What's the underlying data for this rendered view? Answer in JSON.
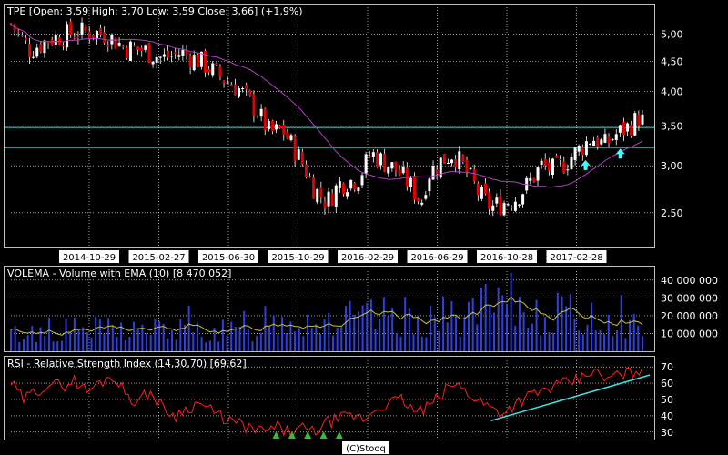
{
  "colors": {
    "background": "#000000",
    "frame": "#c0c0c0",
    "grid": "#ffffff",
    "candle_up": "#ffffff",
    "candle_down": "#e00000",
    "wick": "#ffffff",
    "ema_price": "#b040c0",
    "volume_bar": "#3040e0",
    "volume_ema": "#c8c040",
    "rsi_line": "#ff2020",
    "trendline": "#40e0e0",
    "signal_arrow": "#40ffff",
    "rsi_marker": "#30c030"
  },
  "footer": "(C)Stooq",
  "chart_data": [
    {
      "type": "candlestick",
      "title": "TPE [Open: 3,59  High: 3,70  Low: 3,59  Close: 3,66] (+1,9%)",
      "x_labels": [
        "2014-10-29",
        "2015-02-27",
        "2015-06-30",
        "2015-10-29",
        "2016-02-29",
        "2016-06-29",
        "2016-10-28",
        "2017-02-28"
      ],
      "y_scale": "log",
      "y_ticks": [
        2.5,
        3.0,
        3.5,
        4.0,
        4.5,
        5.0
      ],
      "y_tick_labels": [
        "2,50",
        "3,00",
        "3,50",
        "4,00",
        "4,50",
        "5,00"
      ],
      "ylim": [
        2.2,
        5.55
      ],
      "horizontal_lines": [
        3.48,
        3.22
      ],
      "overlay": "moving average",
      "signal_arrows": [
        0.91,
        0.965
      ],
      "close_path": [
        [
          0,
          5.2
        ],
        [
          0.03,
          4.7
        ],
        [
          0.06,
          4.9
        ],
        [
          0.09,
          5.0
        ],
        [
          0.12,
          5.05
        ],
        [
          0.15,
          5.0
        ],
        [
          0.18,
          4.75
        ],
        [
          0.21,
          4.7
        ],
        [
          0.24,
          4.55
        ],
        [
          0.27,
          4.65
        ],
        [
          0.3,
          4.5
        ],
        [
          0.33,
          4.25
        ],
        [
          0.36,
          4.05
        ],
        [
          0.39,
          3.7
        ],
        [
          0.41,
          3.4
        ],
        [
          0.43,
          3.45
        ],
        [
          0.46,
          3.05
        ],
        [
          0.48,
          2.75
        ],
        [
          0.5,
          2.6
        ],
        [
          0.52,
          2.8
        ],
        [
          0.55,
          2.85
        ],
        [
          0.57,
          3.15
        ],
        [
          0.59,
          3.05
        ],
        [
          0.61,
          2.95
        ],
        [
          0.63,
          2.8
        ],
        [
          0.65,
          2.6
        ],
        [
          0.66,
          2.9
        ],
        [
          0.68,
          3.05
        ],
        [
          0.7,
          3.15
        ],
        [
          0.72,
          2.95
        ],
        [
          0.74,
          2.7
        ],
        [
          0.76,
          2.55
        ],
        [
          0.78,
          2.6
        ],
        [
          0.8,
          2.65
        ],
        [
          0.82,
          2.8
        ],
        [
          0.84,
          3.0
        ],
        [
          0.86,
          2.95
        ],
        [
          0.88,
          3.05
        ],
        [
          0.9,
          3.2
        ],
        [
          0.92,
          3.35
        ],
        [
          0.94,
          3.25
        ],
        [
          0.96,
          3.4
        ],
        [
          0.98,
          3.5
        ],
        [
          1,
          3.66
        ]
      ]
    },
    {
      "type": "bar",
      "title": "VOLEMA - Volume with EMA (10) [8 470 052]",
      "y_ticks": [
        10000000,
        20000000,
        30000000,
        40000000
      ],
      "y_tick_labels": [
        "10 000 000",
        "20 000 000",
        "30 000 000",
        "40 000 000"
      ],
      "ylim": [
        0,
        45000000
      ],
      "volume_profile": [
        [
          0,
          10000000
        ],
        [
          0.1,
          13000000
        ],
        [
          0.2,
          13000000
        ],
        [
          0.3,
          12000000
        ],
        [
          0.38,
          11000000
        ],
        [
          0.4,
          20000000
        ],
        [
          0.5,
          18000000
        ],
        [
          0.6,
          20000000
        ],
        [
          0.7,
          20000000
        ],
        [
          0.75,
          25000000
        ],
        [
          0.8,
          24000000
        ],
        [
          0.85,
          23000000
        ],
        [
          0.9,
          20000000
        ],
        [
          0.95,
          18000000
        ],
        [
          1,
          15000000
        ]
      ],
      "last_value": 8470052
    },
    {
      "type": "line",
      "title": "RSI - Relative Strength Index (14,30,70) [69,62]",
      "y_ticks": [
        30,
        40,
        50,
        60,
        70
      ],
      "y_tick_labels": [
        "30",
        "40",
        "50",
        "60",
        "70"
      ],
      "ylim": [
        26,
        74
      ],
      "last_value": 69.62,
      "rsi_path": [
        [
          0,
          60
        ],
        [
          0.02,
          50
        ],
        [
          0.04,
          55
        ],
        [
          0.06,
          60
        ],
        [
          0.08,
          58
        ],
        [
          0.1,
          62
        ],
        [
          0.12,
          55
        ],
        [
          0.14,
          60
        ],
        [
          0.16,
          65
        ],
        [
          0.18,
          55
        ],
        [
          0.2,
          48
        ],
        [
          0.22,
          55
        ],
        [
          0.24,
          45
        ],
        [
          0.26,
          40
        ],
        [
          0.28,
          45
        ],
        [
          0.3,
          48
        ],
        [
          0.32,
          42
        ],
        [
          0.34,
          38
        ],
        [
          0.36,
          35
        ],
        [
          0.38,
          32
        ],
        [
          0.4,
          30
        ],
        [
          0.42,
          33
        ],
        [
          0.44,
          30
        ],
        [
          0.46,
          32
        ],
        [
          0.48,
          30
        ],
        [
          0.5,
          36
        ],
        [
          0.52,
          38
        ],
        [
          0.54,
          40
        ],
        [
          0.56,
          38
        ],
        [
          0.58,
          45
        ],
        [
          0.6,
          48
        ],
        [
          0.62,
          50
        ],
        [
          0.64,
          42
        ],
        [
          0.66,
          45
        ],
        [
          0.68,
          52
        ],
        [
          0.7,
          60
        ],
        [
          0.72,
          55
        ],
        [
          0.74,
          50
        ],
        [
          0.76,
          45
        ],
        [
          0.78,
          42
        ],
        [
          0.8,
          48
        ],
        [
          0.82,
          52
        ],
        [
          0.84,
          55
        ],
        [
          0.86,
          58
        ],
        [
          0.88,
          60
        ],
        [
          0.9,
          62
        ],
        [
          0.92,
          68
        ],
        [
          0.94,
          62
        ],
        [
          0.96,
          65
        ],
        [
          0.98,
          66
        ],
        [
          1,
          69.62
        ]
      ],
      "trendline": [
        [
          0.76,
          37
        ],
        [
          1,
          65
        ]
      ],
      "oversold_markers": [
        0.42,
        0.445,
        0.47,
        0.495,
        0.52
      ]
    }
  ]
}
